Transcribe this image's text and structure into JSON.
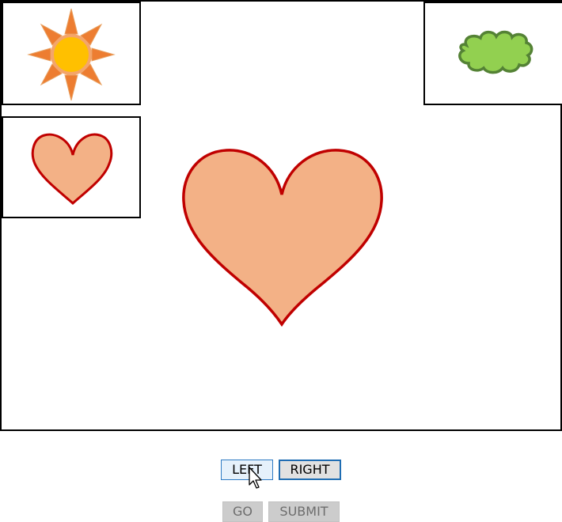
{
  "stage": {
    "slots": {
      "top_left": "sun",
      "top_right": "cloud",
      "middle_left": "heart"
    },
    "center_shape": "heart"
  },
  "controls": {
    "left_label": "LEFT",
    "right_label": "RIGHT",
    "go_label": "GO",
    "submit_label": "SUBMIT"
  },
  "colors": {
    "heart_fill": "#f3b186",
    "heart_stroke": "#c00000",
    "sun_fill": "#ffc000",
    "sun_stroke": "#ed7d31",
    "cloud_fill": "#92d050",
    "cloud_stroke": "#548235",
    "button_focus_border": "#1f6db3",
    "button_disabled_bg": "#cccccc"
  }
}
